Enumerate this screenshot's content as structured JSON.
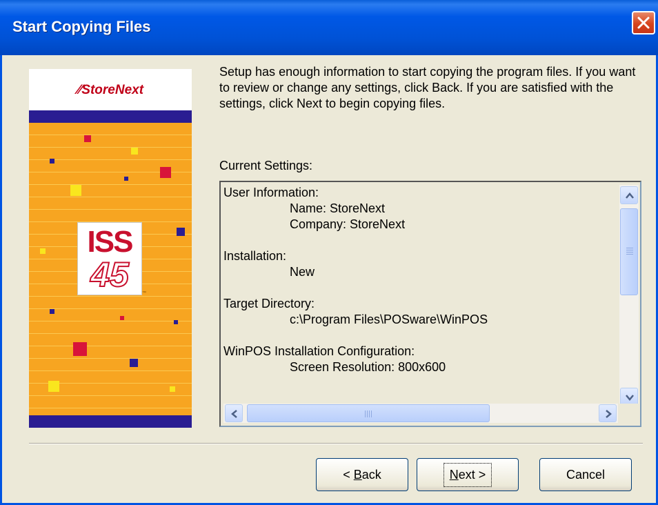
{
  "window": {
    "title": "Start Copying Files",
    "titlebar_color": "#0058e6",
    "close_button_color": "#d7441d"
  },
  "banner": {
    "logo_text": "StoreNext",
    "product_line1": "ISS",
    "product_line2": "45",
    "trademark": "™",
    "background_color": "#f7a521",
    "stripe_color": "#2a1d92"
  },
  "description": "Setup has enough information to start copying the program files. If you want to review or change any settings, click Back.  If you are satisfied with the settings, click Next to begin copying files.",
  "current_settings": {
    "label": "Current Settings:",
    "lines": {
      "l0": "User Information:",
      "l1": "Name: StoreNext",
      "l2": "Company: StoreNext",
      "l3": "Installation:",
      "l4": "New",
      "l5": "Target Directory:",
      "l6": "c:\\Program Files\\POSware\\WinPOS",
      "l7": "WinPOS Installation Configuration:",
      "l8": "Screen Resolution: 800x600"
    },
    "vertical_scroll_position": 0.0,
    "horizontal_scroll_position": 0.0
  },
  "buttons": {
    "back_prefix": "< ",
    "back_mnemonic": "B",
    "back_rest": "ack",
    "next_mnemonic": "N",
    "next_rest": "ext >",
    "cancel": "Cancel"
  }
}
